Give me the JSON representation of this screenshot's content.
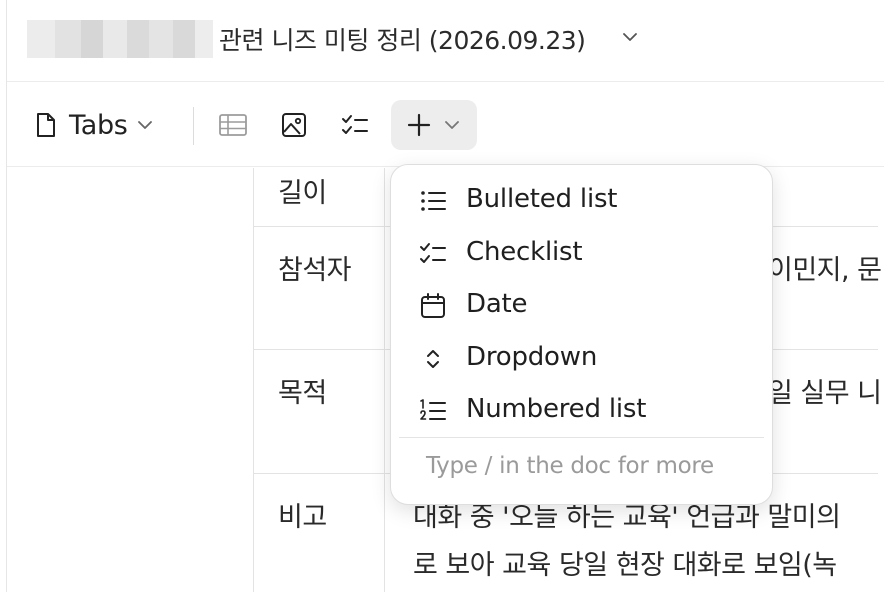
{
  "header": {
    "title": "관련 니즈 미팅 정리 (2026.09.23)"
  },
  "toolbar": {
    "tabs_label": "Tabs"
  },
  "table": {
    "rows": [
      {
        "label": "길이",
        "value": ""
      },
      {
        "label": "참석자",
        "value": "이민지, 문"
      },
      {
        "label": "목적",
        "value": "일 실무 니"
      },
      {
        "label": "비고",
        "value": "대화 중 '오늘 하는 교육' 언급과 말미의",
        "value2": "로 보아 교육 당일 현장 대화로 보임(녹"
      }
    ]
  },
  "insert_menu": {
    "items": [
      {
        "label": "Bulleted list",
        "icon": "bulleted-list-icon"
      },
      {
        "label": "Checklist",
        "icon": "checklist-icon"
      },
      {
        "label": "Date",
        "icon": "calendar-icon"
      },
      {
        "label": "Dropdown",
        "icon": "dropdown-icon"
      },
      {
        "label": "Numbered list",
        "icon": "numbered-list-icon"
      }
    ],
    "hint": "Type / in the doc for more"
  },
  "colors": {
    "accent_bg": "#ededed",
    "text": "#1f1f1f",
    "muted": "#9a9a9a",
    "border": "#e3e3e3"
  }
}
